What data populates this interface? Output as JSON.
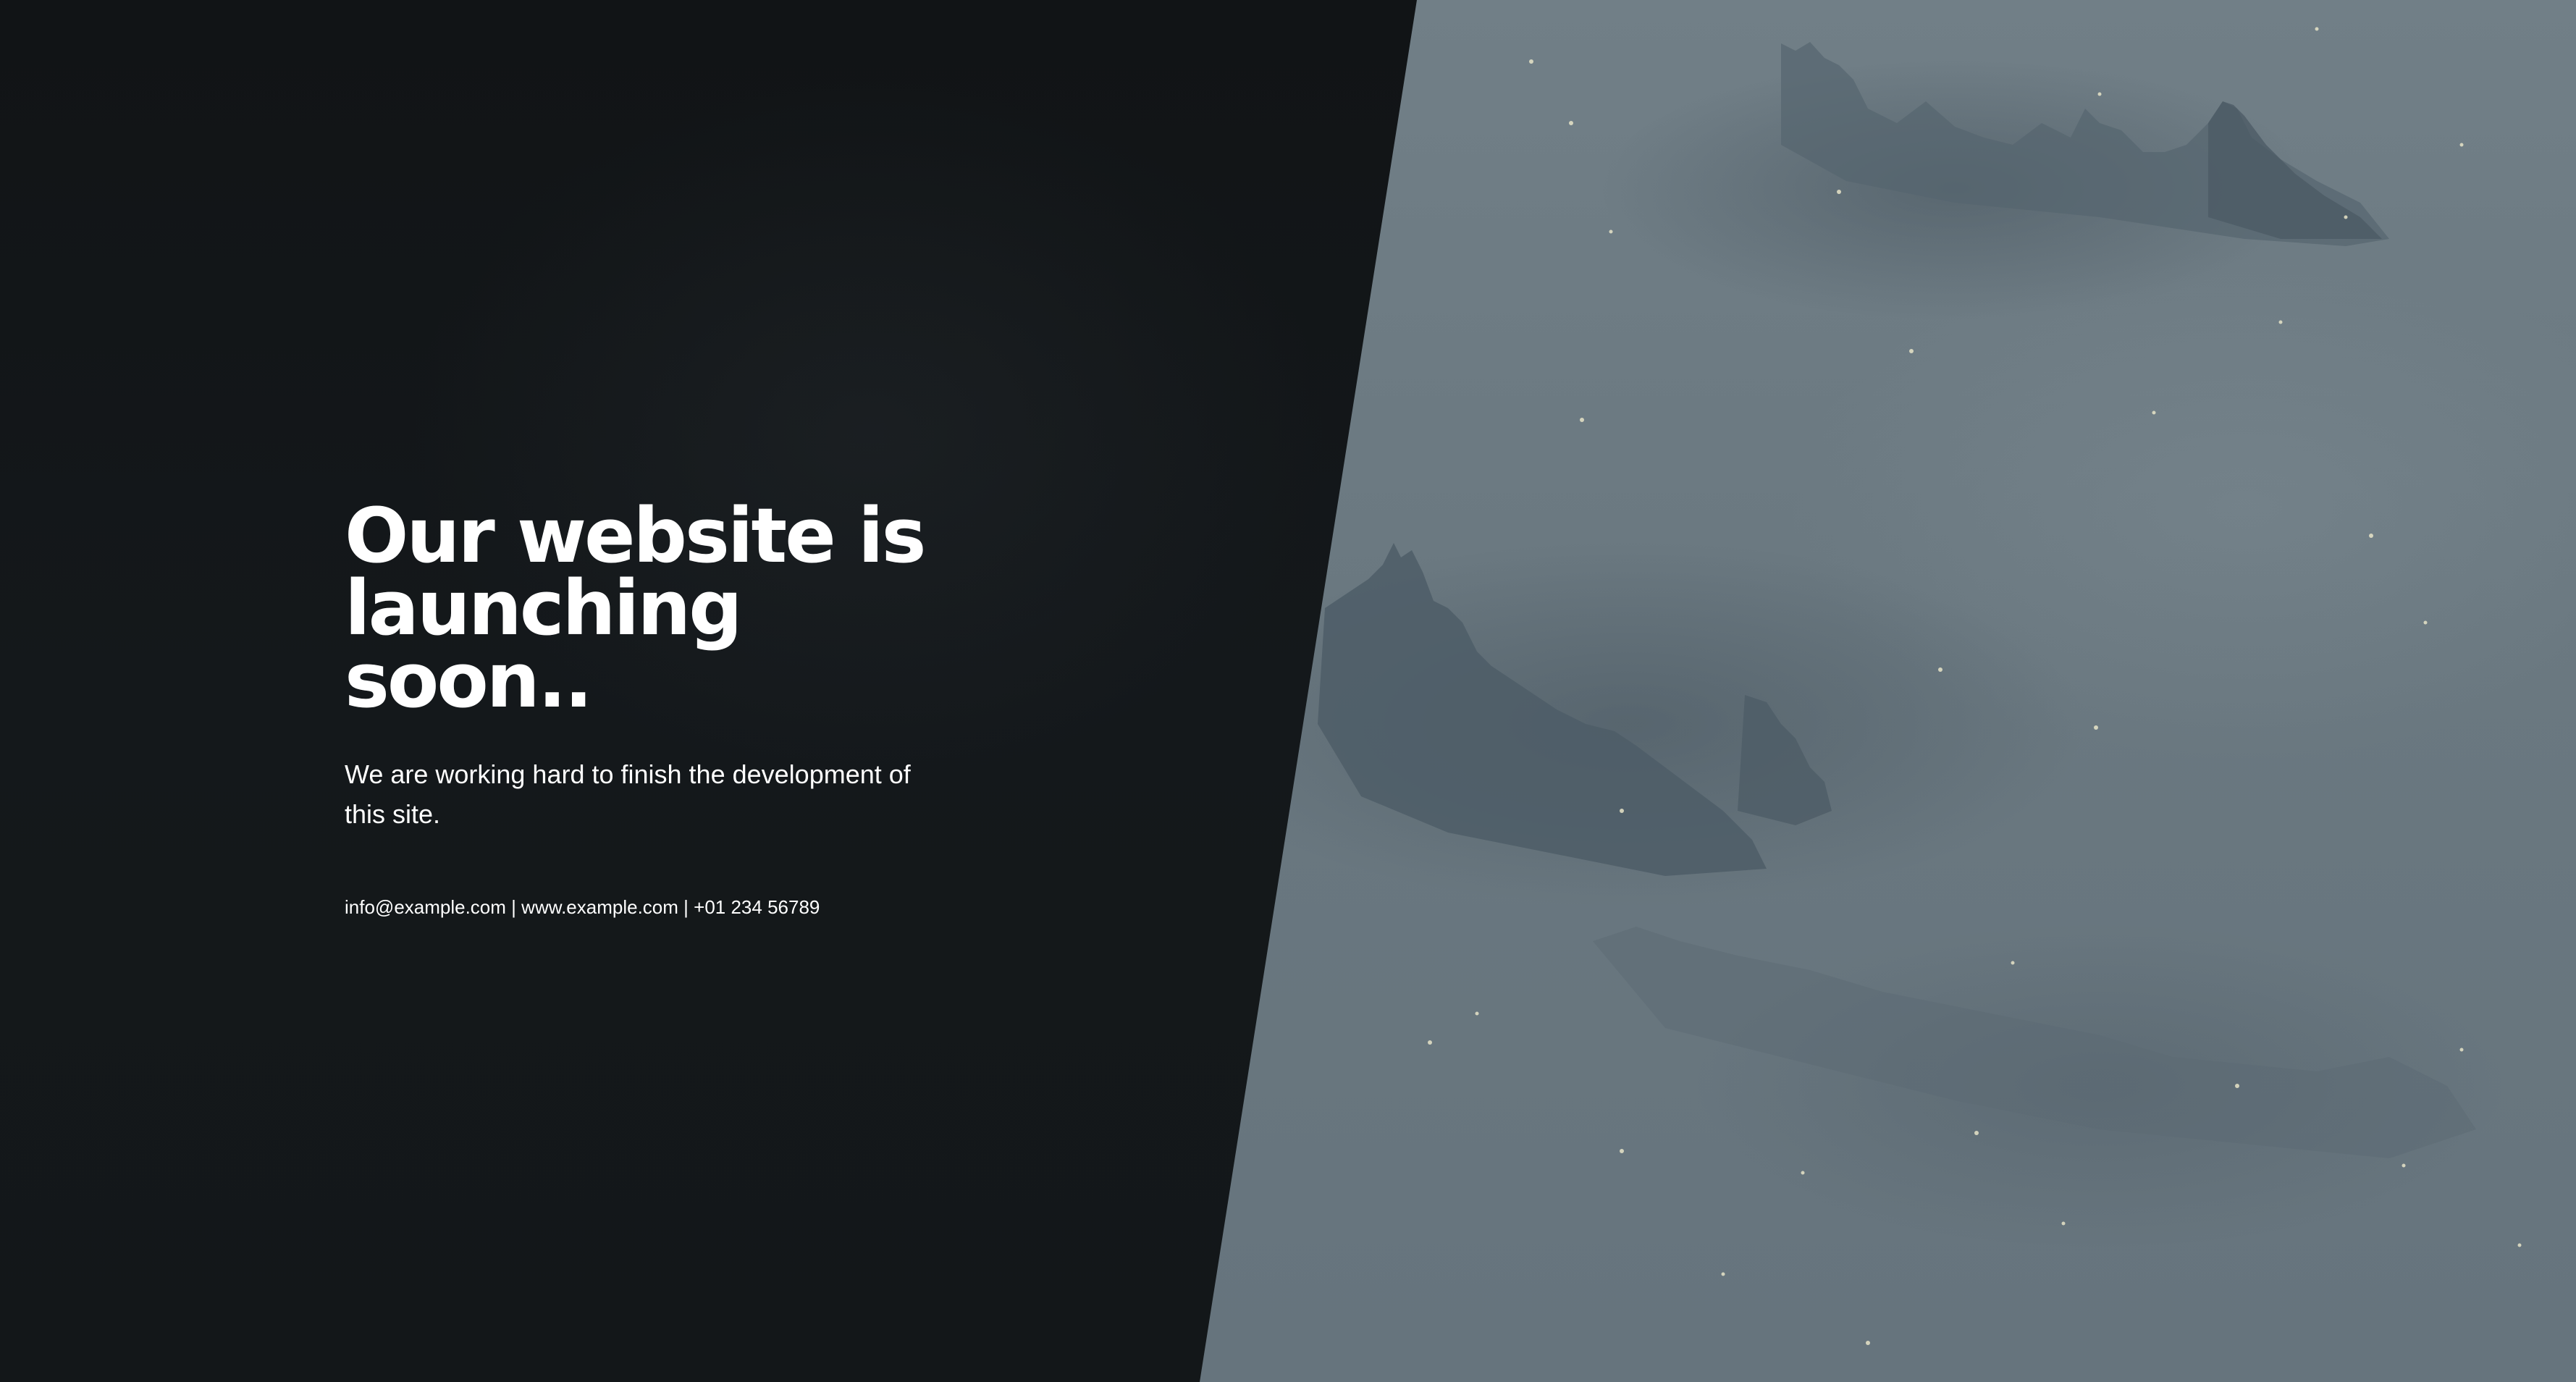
{
  "hero": {
    "headline_line1": "Our website is",
    "headline_line2": "launching soon..",
    "subtitle_line1": "We are working hard to finish the development of",
    "subtitle_line2": "this site."
  },
  "contact": {
    "email": "info@example.com",
    "separator": "|",
    "website": "www.example.com",
    "phone": "+01 234 56789"
  },
  "colors": {
    "dark_panel": "#131719",
    "fog_image": "#6b7a83",
    "text": "#ffffff"
  }
}
